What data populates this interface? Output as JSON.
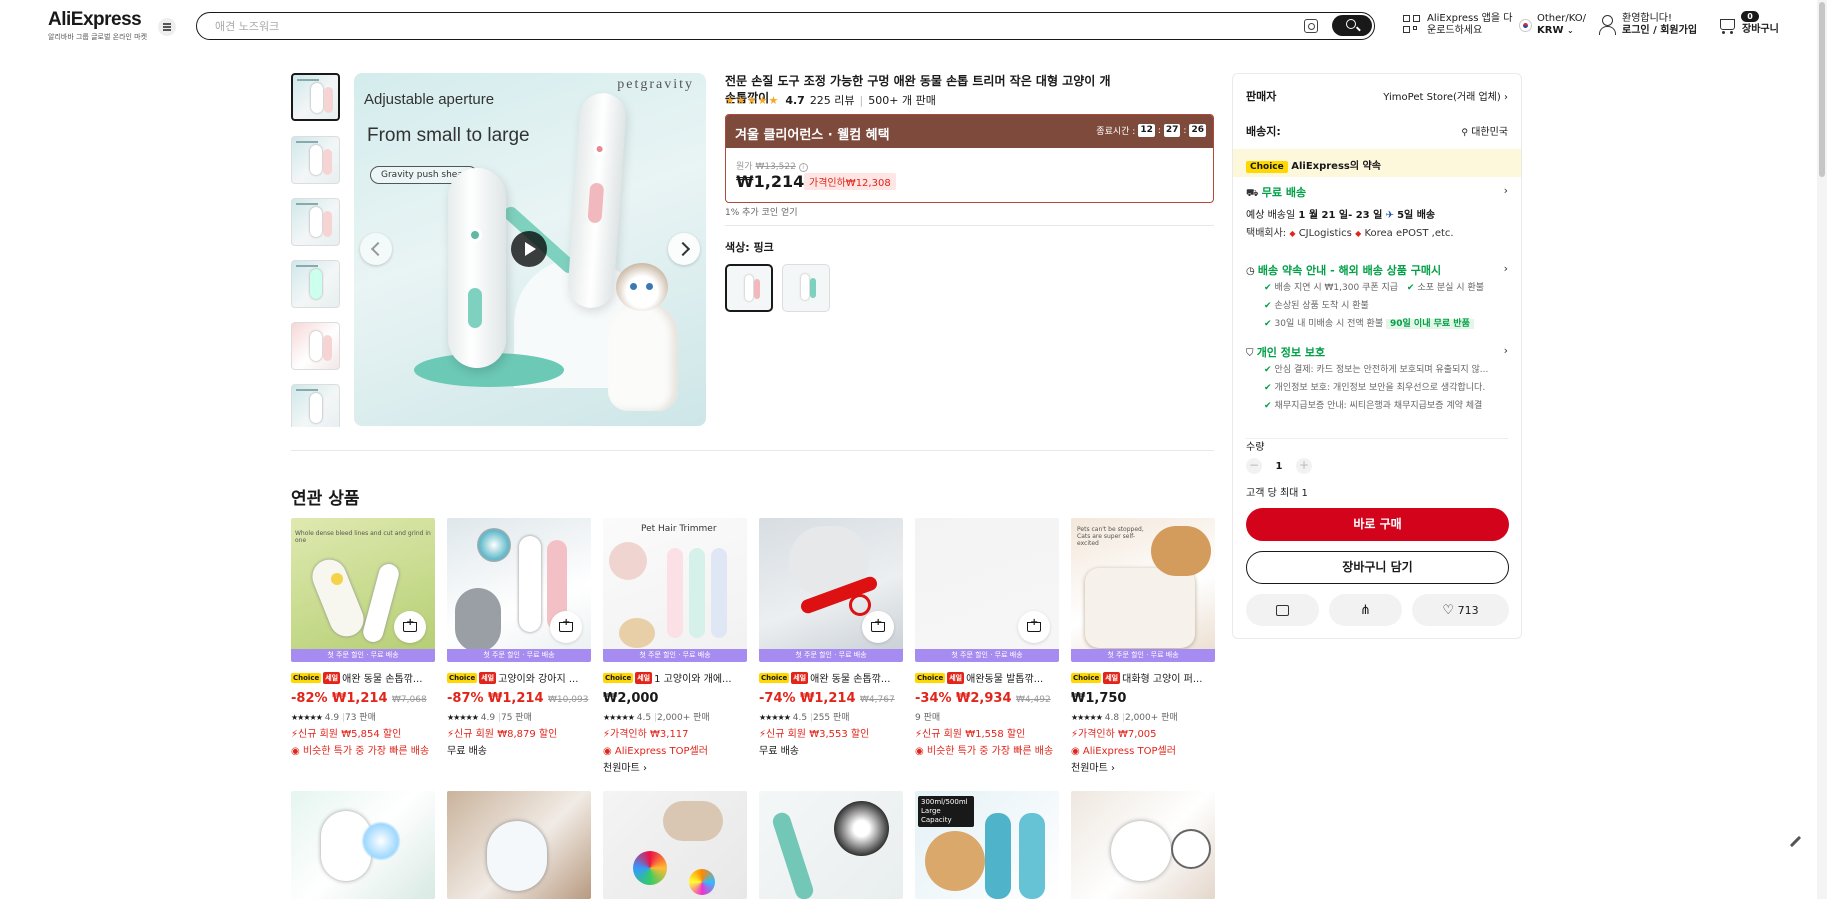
{
  "header": {
    "logo": "AliExpress",
    "logo_sub": "알리바바 그룹 글로벌 온라인 마켓",
    "search_placeholder": "애견 노즈워크",
    "app_line1": "AliExpress 앱을 다",
    "app_line2": "운로드하세요",
    "region_line1": "Other/KO/",
    "region_line2": "KRW",
    "user_line1": "환영합니다!",
    "user_line2": "로그인 / 회원가입",
    "cart_count": "0",
    "cart_label": "장바구니"
  },
  "product": {
    "title": "전문 손질 도구 조정 가능한 구멍 애완 동물 손톱 트리머 작은 대형 고양이 개 손톱깎이",
    "rating": "4.7",
    "reviews": "225 리뷰",
    "sold": "500+ 개 판매",
    "image_text1": "Adjustable aperture",
    "image_text2": "From small to large",
    "image_pill": "Gravity push shear",
    "image_brand": "petgravity",
    "promo_name": "겨울 클리어런스 · 웰컴 혜택",
    "timer_label": "종료시간 :",
    "timer_h": "12",
    "timer_m": "27",
    "timer_s": "26",
    "orig_label": "원가",
    "orig_price": "₩13,522",
    "price": "₩1,214",
    "discount": "가격인하₩12,308",
    "coin_text": "1% 추가 코인 얻기",
    "color_label": "색상: 핑크"
  },
  "sidebar": {
    "seller_label": "판매자",
    "seller_value": "YimoPet Store(거래 업체)",
    "ship_label": "배송지:",
    "ship_value": "대한민국",
    "choice_tag": "Choice",
    "choice_text": "AliExpress의 약속",
    "free_ship": "무료 배송",
    "est_prefix": "예상 배송일",
    "est_dates": "1 월 21 일- 23 일",
    "est_days": "5일 배송",
    "courier_label": "택배회사:",
    "courier1": "CJLogistics",
    "courier2": "Korea ePOST ,etc.",
    "promise_title": "배송 약속 안내 - 해외 배송 상품 구매시",
    "promise1": "배송 지연 시 ₩1,300 쿠폰 지급",
    "promise2": "소포 분실 시 환불",
    "promise3": "손상된 상품 도착 시 환불",
    "promise4": "30일 내 미배송 시 전액 환불",
    "promise4_badge": "90일 이내 무료 반품",
    "privacy_title": "개인 정보 보호",
    "privacy1": "안심 결제: 카드 정보는 안전하게 보호되며 유출되지 않...",
    "privacy2": "개인정보 보호: 개인정보 보안을 최우선으로 생각합니다.",
    "privacy3": "채무지급보증 안내: 씨티은행과 채무지급보증 계약 체결",
    "qty_label": "수량",
    "qty_value": "1",
    "qty_max": "고객 당 최대 1",
    "buy_label": "바로 구매",
    "cart_label": "장바구니 담기",
    "wish_count": "713"
  },
  "related": {
    "title": "연관 상품",
    "strip": "첫 주문 할인 · 무료 배송",
    "items": [
      {
        "name": "애완 동물 손톱깎...",
        "price": "-82% ₩1,214",
        "old": "₩7,068",
        "rating": "4.9",
        "sold": "73 판매",
        "promo": "신규 회원 ₩5,854 할인",
        "line3": "비슷한 특가 중 가장 빠른 배송",
        "line4": "",
        "sale": true,
        "choice": true
      },
      {
        "name": "고양이와 강아지 ...",
        "price": "-87% ₩1,214",
        "old": "₩10,093",
        "rating": "4.9",
        "sold": "75 판매",
        "promo": "신규 회원 ₩8,879 할인",
        "line3": "무료 배송",
        "line4": "",
        "sale": true,
        "choice": true
      },
      {
        "name": "1 고양이와 개에...",
        "price": "₩2,000",
        "old": "",
        "rating": "4.5",
        "sold": "2,000+ 판매",
        "promo": "가격인하 ₩3,117",
        "line3": "AliExpress TOP셀러",
        "line4": "천원마트",
        "sale": true,
        "choice": true
      },
      {
        "name": "애완 동물 손톱깎...",
        "price": "-74% ₩1,214",
        "old": "₩4,767",
        "rating": "4.5",
        "sold": "255 판매",
        "promo": "신규 회원 ₩3,553 할인",
        "line3": "무료 배송",
        "line4": "",
        "sale": true,
        "choice": true
      },
      {
        "name": "애완동물 발톱깎...",
        "price": "-34% ₩2,934",
        "old": "₩4,492",
        "rating": "",
        "sold": "9 판매",
        "promo": "신규 회원 ₩1,558 할인",
        "line3": "비슷한 특가 중 가장 빠른 배송",
        "line4": "",
        "sale": true,
        "choice": true
      },
      {
        "name": "대화형 고양이 퍼...",
        "price": "₩1,750",
        "old": "",
        "rating": "4.8",
        "sold": "2,000+ 판매",
        "promo": "가격인하 ₩7,005",
        "line3": "AliExpress TOP셀러",
        "line4": "천원마트",
        "sale": true,
        "choice": true
      }
    ],
    "card_texts": {
      "c0": "Whole dense bleed lines and cut and grind in one",
      "c2": "Pet Hair Trimmer",
      "c5": "Pets can't be stopped, Cats are super self-excited",
      "r4": "300ml/500ml Large Capacity"
    }
  },
  "colors": {
    "accent_red": "#e1251b",
    "buy_red": "#d3031c",
    "promo_brown": "#7d4a3c",
    "green": "#00a046",
    "choice_yellow": "#ffd800",
    "strip_purple": "#a68cf0"
  }
}
